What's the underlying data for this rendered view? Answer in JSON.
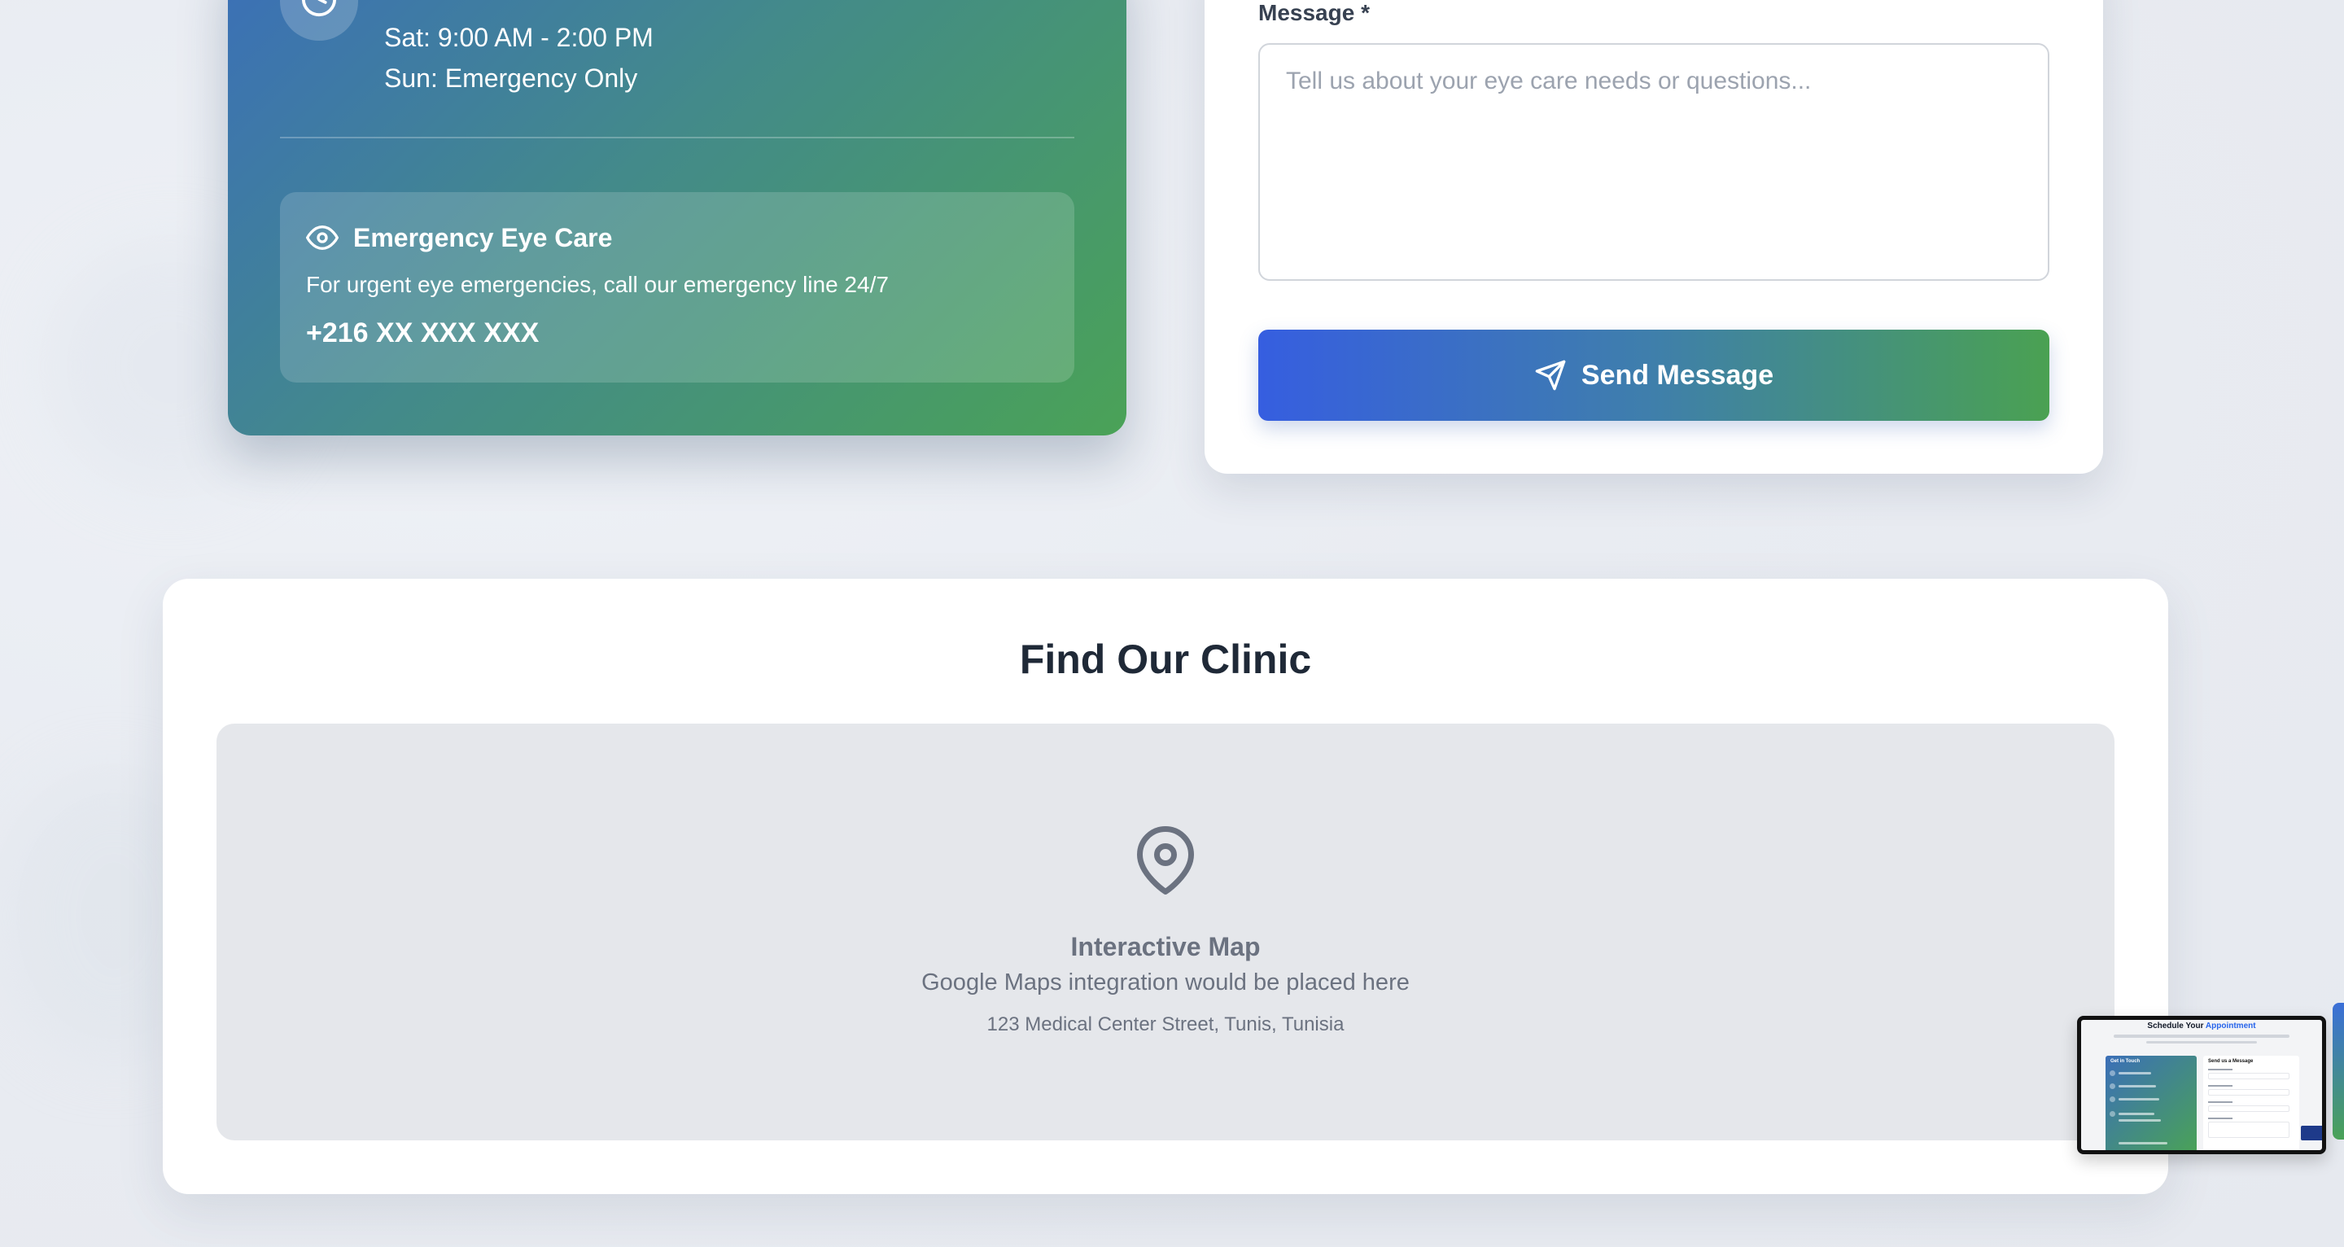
{
  "hours": {
    "saturday": "Sat: 9:00 AM - 2:00 PM",
    "sunday": "Sun: Emergency Only",
    "icon": "clock-icon"
  },
  "emergency": {
    "icon": "eye-icon",
    "title": "Emergency Eye Care",
    "description": "For urgent eye emergencies, call our emergency line 24/7",
    "phone": "+216 XX XXX XXX"
  },
  "contact_form": {
    "message_label": "Message *",
    "message_placeholder": "Tell us about your eye care needs or questions...",
    "message_value": "",
    "send_label": "Send Message",
    "send_icon": "send-icon"
  },
  "clinic": {
    "title": "Find Our Clinic",
    "map": {
      "icon": "map-pin-icon",
      "title": "Interactive Map",
      "subtitle": "Google Maps integration would be placed here",
      "address": "123 Medical Center Street, Tunis, Tunisia"
    }
  },
  "thumbnail": {
    "title_prefix": "Schedule Your",
    "title_accent": "Appointment",
    "left_title": "Get in Touch",
    "right_title": "Send us a Message"
  },
  "colors": {
    "gradient_start": "#3b6fb8",
    "gradient_end": "#4aa257",
    "button_start": "#365ee0",
    "button_end": "#4aa152"
  }
}
